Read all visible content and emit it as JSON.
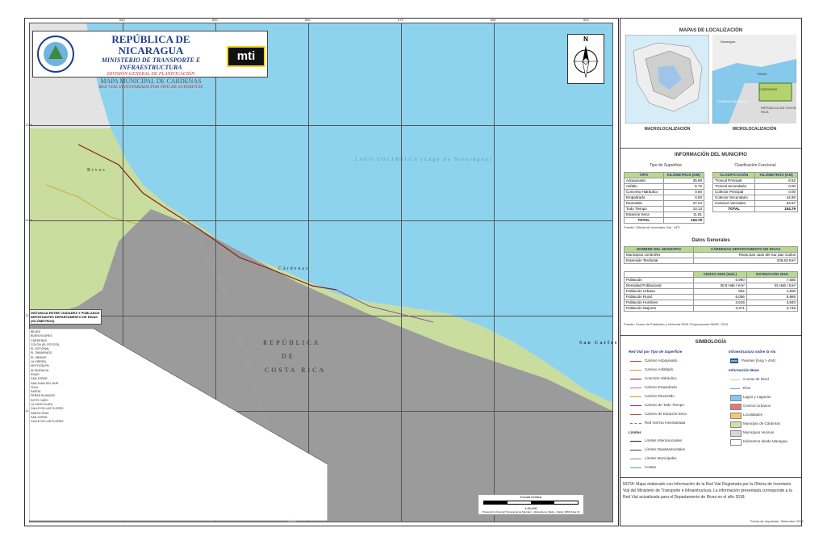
{
  "title_block": {
    "country": "REPÚBLICA DE NICARAGUA",
    "ministry": "MINISTERIO DE TRANSPORTE E INFRAESTRUCTURA",
    "division": "DIVISIÓN GENERAL DE PLANIFICACIÓN",
    "map_name": "MAPA MUNICIPAL DE CARDENAS",
    "subtitle": "RED VIAL INVENTARIADA POR TIPO DE SUPERFICIE",
    "logo_text": "mti"
  },
  "north_label": "N",
  "map_labels": {
    "lake": "LAGO COCIBOLCA (Lago de Nicaragua)",
    "rivas": "Rivas",
    "cardenas": "Cárdenas",
    "san_carlos": "San Carlos",
    "republica": "REPÚBLICA",
    "de": "DE",
    "costa_rica": "COSTA RICA"
  },
  "ticks_top": [
    "640",
    "650",
    "660",
    "670",
    "680",
    "690",
    "700"
  ],
  "ticks_left": [
    "1250",
    "1240",
    "1230",
    "1220",
    "1210"
  ],
  "distance_table": {
    "title": "DISTANCIA ENTRE CIUDADES Y POBLADOS IMPORTANTES DEPARTAMENTO DE RIVAS",
    "unit": "(KILÓMETROS)",
    "rows": [
      "BELEN",
      "BUENOS AIRES",
      "CÁRDENAS",
      "COLÓN (EL POTOSÍ)",
      "EL OSTIONAL",
      "EL TAMARINDO",
      "EL OBRAJE",
      "LA VIRGEN",
      "MOYOGALPA",
      "ALTAGRACIA",
      "RIVAS",
      "SAN JORGE",
      "SAN JUAN DEL SUR",
      "TOLA",
      "SAPOÁ",
      "PEÑAS BLANCAS",
      "SOTO CAÑO",
      "LA CHOCOLATA",
      "CALLE DE LAS FLORES",
      "SANTA CRUZ",
      "SAN JORGE",
      "CALLE DE LAS FLORES"
    ]
  },
  "scale": {
    "label": "Escala Gráfica",
    "ratio": "1:90,000",
    "projection": "Proyección Universal Transversal de Mercator - Elipsoide de Clarke - Datum 1866 Zona 16"
  },
  "side": {
    "location_title": "MAPAS DE LOCALIZACIÓN",
    "macro_label": "MACROLOCALIZACIÓN",
    "micro_label": "MICROLOCALIZACIÓN",
    "micro_tags": [
      "Nicaragua",
      "RIVAS",
      "CÁRDENAS",
      "OCÉANO PACÍFICO",
      "REPÚBLICA DE COSTA RICA"
    ],
    "info_title": "INFORMACIÓN DEL MUNICIPIO",
    "surface_title": "Tipo de Superficie",
    "functional_title": "Clasificación Funcional",
    "surface_headers": [
      "TIPO",
      "KILÓMETROS (KM)"
    ],
    "surface_rows": [
      [
        "Adoquinado",
        "35.68"
      ],
      [
        "Asfalto",
        "5.72"
      ],
      [
        "Concreto Hidráulico",
        "0.60"
      ],
      [
        "Empedrado",
        "0.00"
      ],
      [
        "Revestido",
        "27.24"
      ],
      [
        "Todo Tiempo",
        "10.13"
      ],
      [
        "Estación Seca",
        "11.81"
      ]
    ],
    "surface_total": [
      "TOTAL",
      "104.79"
    ],
    "functional_headers": [
      "CLASIFICACIÓN",
      "KILÓMETROS (KM)"
    ],
    "functional_rows": [
      [
        "Troncal Principal",
        "6.52"
      ],
      [
        "Troncal Secundaria",
        "0.00"
      ],
      [
        "Colector Principal",
        "0.00"
      ],
      [
        "Colector Secundario",
        "44.90"
      ],
      [
        "Caminos Vecinales",
        "53.57"
      ]
    ],
    "functional_total": [
      "TOTAL",
      "104.79"
    ],
    "source1": "Fuente: Oficina de Inventario Vial - MTI.",
    "general_title": "Datos Generales",
    "general_head": [
      "NOMBRE DEL MUNICIPIO",
      "CÁRDENAS DEPARTAMENTO DE RIVAS"
    ],
    "general_rows": [
      [
        "Municipios Limítrofes",
        "Rivas,San Juan del Sur,San Carlos"
      ],
      [
        "Extensión Territorial",
        "226.63 Km²"
      ]
    ],
    "census_head": [
      "",
      "CENSO 2005 (Hab.)",
      "ESTIMACIÓN 2019"
    ],
    "census_rows": [
      [
        "Población",
        "6,990",
        "7,585"
      ],
      [
        "Densidad Poblacional",
        "30.8 Hab / Km²",
        "33 Hab / Km²"
      ],
      [
        "Población Urbana",
        "934",
        "1,600"
      ],
      [
        "Población Rural",
        "6,056",
        "5,985"
      ],
      [
        "Población Hombres",
        "3,619",
        "3,840"
      ],
      [
        "Población Mujeres",
        "3,371",
        "3,745"
      ]
    ],
    "source2": "Fuente: Censo de Población y Vivienda 2005. Proyecciones INIDE, 2019",
    "legend_title": "SIMBOLOGÍA",
    "road_legend_title": "Red Vial por Tipo de Superficie",
    "infra_title": "Infraestructura sobre la Vía",
    "road_types": [
      {
        "label": "Camino Adoquinado",
        "color": "#c0392b"
      },
      {
        "label": "Camino Asfaltado",
        "color": "#e8863a"
      },
      {
        "label": "Concreto Hidráulico",
        "color": "#8b1a1a"
      },
      {
        "label": "Camino Empedrado",
        "color": "#d65a8a"
      },
      {
        "label": "Camino Revestido",
        "color": "#c9a227"
      },
      {
        "label": "Camino de Todo Tiempo",
        "color": "#7a2f8f"
      },
      {
        "label": "Camino de Estación Seca",
        "color": "#a05a2c"
      },
      {
        "label": "Red Vial No Inventariada",
        "color": "#777777"
      }
    ],
    "limits_title": "Límites",
    "limits": [
      {
        "label": "Límites Internacionales",
        "color": "#222222"
      },
      {
        "label": "Límites Departamentales",
        "color": "#444444"
      },
      {
        "label": "Límites Municipales",
        "color": "#888888"
      },
      {
        "label": "Costas",
        "color": "#4aa3d8"
      }
    ],
    "infra": [
      {
        "label": "Puentes (long > 4mt)"
      }
    ],
    "base_title": "Información Base",
    "base": [
      {
        "label": "Curvas de Nivel",
        "color": "#d9c89a",
        "kind": "line"
      },
      {
        "label": "Ríos",
        "color": "#5aa7e0",
        "kind": "line"
      },
      {
        "label": "Lagos y Lagunas",
        "color": "#86c8ee",
        "kind": "box"
      },
      {
        "label": "Centros Urbanos",
        "color": "#e77a6a",
        "kind": "box"
      },
      {
        "label": "Localidades",
        "color": "#f3c77b",
        "kind": "box"
      },
      {
        "label": "Municipio de Cárdenas",
        "color": "#cfe1a7",
        "kind": "box"
      },
      {
        "label": "Municipios Vecinos",
        "color": "#d7d7d7",
        "kind": "box"
      },
      {
        "label": "Kilómetros desde Managua",
        "color": "#ffffff",
        "kind": "box"
      }
    ],
    "note": "NOTA: Mapa elaborado con información de la Red Vial Registrada por la Oficina de Inventario Vial del Ministerio de Transporte e Infraestructura. La información presentada corresponde a la Red Vial actualizada para el Departamento de Rivas en el año 2018.",
    "print_date": "Fecha de Impresión: Diciembre 2019"
  },
  "colors": {
    "lake": "#8ed3ee",
    "land": "#c9dd9f",
    "costa_rica": "#9b9b9b",
    "neighbor": "#e3e3e3",
    "brand_blue": "#1d3e8c"
  }
}
